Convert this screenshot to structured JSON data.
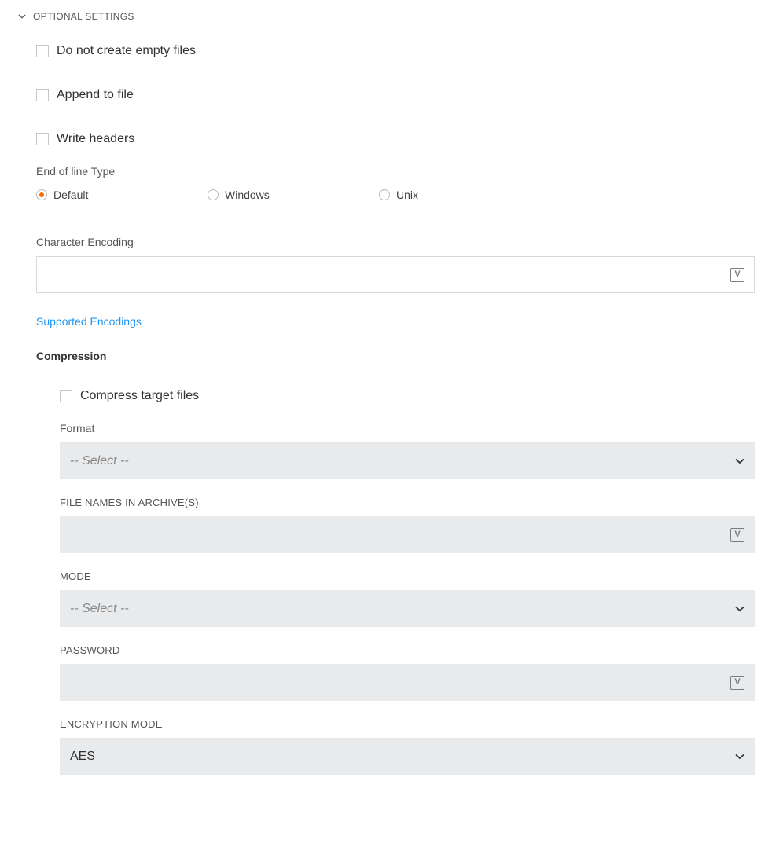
{
  "sectionTitle": "OPTIONAL SETTINGS",
  "checkboxes": {
    "noEmpty": "Do not create empty files",
    "append": "Append to file",
    "writeHeaders": "Write headers",
    "compress": "Compress target files"
  },
  "eol": {
    "label": "End of line Type",
    "options": {
      "default": "Default",
      "windows": "Windows",
      "unix": "Unix"
    }
  },
  "charEncoding": {
    "label": "Character Encoding"
  },
  "supportedEncodingsLink": "Supported Encodings",
  "compression": {
    "title": "Compression",
    "format": {
      "label": "Format",
      "placeholder": "-- Select --"
    },
    "fileNames": {
      "label": "FILE NAMES IN ARCHIVE(S)"
    },
    "mode": {
      "label": "MODE",
      "placeholder": "-- Select --"
    },
    "password": {
      "label": "PASSWORD"
    },
    "encryptionMode": {
      "label": "ENCRYPTION MODE",
      "value": "AES"
    }
  },
  "varIconGlyph": "V"
}
